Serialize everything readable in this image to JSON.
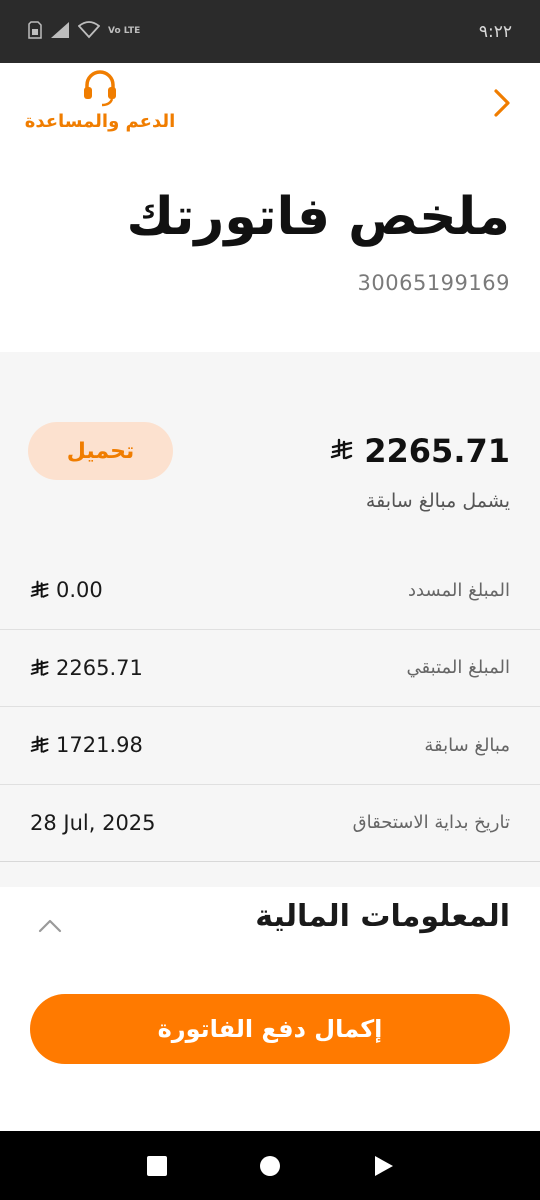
{
  "status_bar": {
    "time": "٩:٢٢",
    "lte_label": "Vo LTE",
    "icons": [
      "sim-icon",
      "signal-icon",
      "wifi-icon",
      "volte-icon"
    ]
  },
  "header": {
    "back_icon": "chevron-right-icon",
    "support_icon": "headset-icon",
    "support_label": "الدعم والمساعدة",
    "title": "ملخص فاتورتك",
    "invoice_number": "30065199169"
  },
  "summary": {
    "total_amount": "2265.71",
    "currency_icon": "saudi-riyal-icon",
    "total_note": "يشمل مبالغ سابقة",
    "download_label": "تحميل",
    "rows": [
      {
        "label": "المبلغ المسدد",
        "value": "0.00",
        "currency": true
      },
      {
        "label": "المبلغ المتبقي",
        "value": "2265.71",
        "currency": true
      },
      {
        "label": "مبالغ سابقة",
        "value": "1721.98",
        "currency": true
      },
      {
        "label": "تاريخ بداية الاستحقاق",
        "value": "28 Jul, 2025",
        "currency": false
      }
    ]
  },
  "financial_info": {
    "title": "المعلومات المالية",
    "toggle_icon": "chevron-up-icon"
  },
  "pay_button_label": "إكمال دفع الفاتورة",
  "nav_bar": {
    "icons": [
      "recent-apps-icon",
      "home-icon",
      "back-icon"
    ]
  },
  "colors": {
    "accent": "#ff7a00",
    "accent_light": "#fce1cf",
    "status_bar_bg": "#2b2b2b",
    "nav_bar_bg": "#000000"
  }
}
